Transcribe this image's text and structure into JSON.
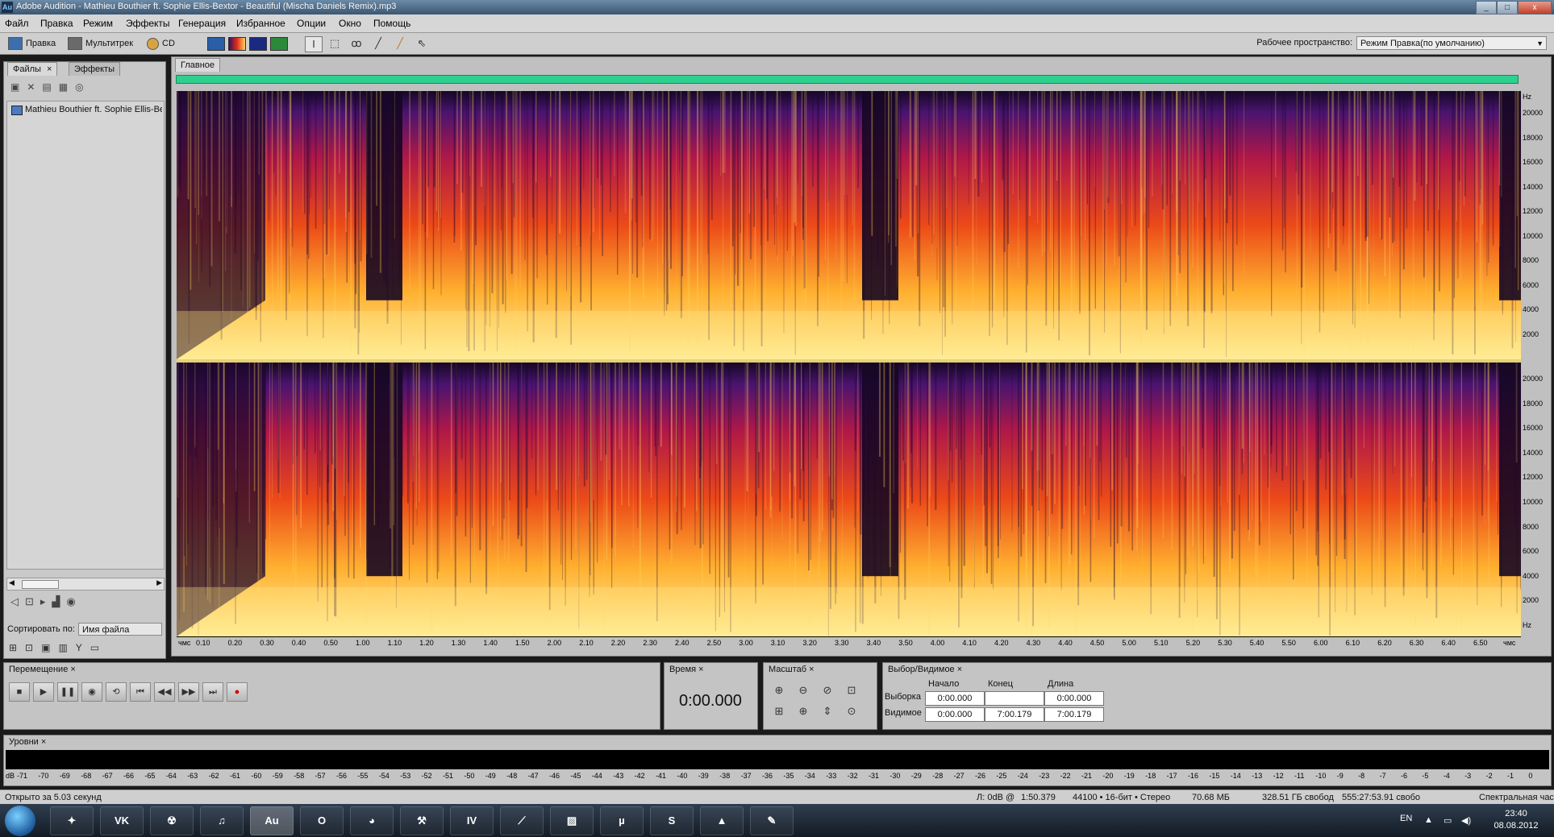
{
  "window": {
    "app_icon": "Au",
    "title": "Adobe Audition - Mathieu Bouthier ft. Sophie Ellis-Bextor - Beautiful (Mischa Daniels Remix).mp3",
    "controls": {
      "minimize": "_",
      "maximize": "□",
      "close": "x"
    }
  },
  "menubar": [
    "Файл",
    "Правка",
    "Режим",
    "Эффекты",
    "Генерация",
    "Избранное",
    "Опции",
    "Окно",
    "Помощь"
  ],
  "toolbar": {
    "mode_edit": "Правка",
    "mode_multitrack": "Мультитрек",
    "mode_cd": "CD",
    "workspace_label": "Рабочее пространство:",
    "workspace_value": "Режим Правка(по умолчанию)",
    "view_buttons": [
      "waveform-view",
      "spectral-frequency-view",
      "spectral-pan-view",
      "spectral-phase-view"
    ],
    "tools": [
      "time-selection-tool",
      "marquee-tool",
      "lasso-tool",
      "effects-paintbrush-tool",
      "spot-healing-tool",
      "scrub-tool"
    ]
  },
  "files_panel": {
    "tabs": [
      "Файлы",
      "Эффекты"
    ],
    "tab_close": "×",
    "files": [
      "Mathieu Bouthier ft. Sophie Ellis-Bextor - Beautiful (Mischa Daniels Remix).mp3"
    ],
    "sort_label": "Сортировать по:",
    "sort_value": "Имя файла"
  },
  "editor": {
    "tab": "Главное",
    "hz_label": "Hz",
    "freq_ticks_ch1": [
      "20000",
      "18000",
      "16000",
      "14000",
      "12000",
      "10000",
      "8000",
      "6000",
      "4000",
      "2000"
    ],
    "freq_ticks_ch2": [
      "20000",
      "18000",
      "16000",
      "14000",
      "12000",
      "10000",
      "8000",
      "6000",
      "4000",
      "2000",
      "Hz"
    ],
    "time_unit": "чмс",
    "time_ticks": [
      "0.10",
      "0.20",
      "0.30",
      "0.40",
      "0.50",
      "1.00",
      "1.10",
      "1.20",
      "1.30",
      "1.40",
      "1.50",
      "2.00",
      "2.10",
      "2.20",
      "2.30",
      "2.40",
      "2.50",
      "3.00",
      "3.10",
      "3.20",
      "3.30",
      "3.40",
      "3.50",
      "4.00",
      "4.10",
      "4.20",
      "4.30",
      "4.40",
      "4.50",
      "5.00",
      "5.10",
      "5.20",
      "5.30",
      "5.40",
      "5.50",
      "6.00",
      "6.10",
      "6.20",
      "6.30",
      "6.40",
      "6.50"
    ],
    "time_end": "чмс"
  },
  "transport": {
    "title": "Перемещение",
    "buttons": [
      "stop",
      "play",
      "pause",
      "play-from-cursor",
      "loop",
      "go-to-start",
      "rewind",
      "fast-forward",
      "go-to-end",
      "record"
    ]
  },
  "time_panel": {
    "title": "Время",
    "value": "0:00.000"
  },
  "zoom_panel": {
    "title": "Масштаб"
  },
  "selection_panel": {
    "title": "Выбор/Видимое",
    "headers": [
      "Начало",
      "Конец",
      "Длина"
    ],
    "rows": [
      {
        "label": "Выборка",
        "start": "0:00.000",
        "end": "",
        "length": "0:00.000"
      },
      {
        "label": "Видимое",
        "start": "0:00.000",
        "end": "7:00.179",
        "length": "7:00.179"
      }
    ]
  },
  "levels": {
    "title": "Уровни",
    "unit": "dB",
    "scale": [
      "-71",
      "-70",
      "-69",
      "-68",
      "-67",
      "-66",
      "-65",
      "-64",
      "-63",
      "-62",
      "-61",
      "-60",
      "-59",
      "-58",
      "-57",
      "-56",
      "-55",
      "-54",
      "-53",
      "-52",
      "-51",
      "-50",
      "-49",
      "-48",
      "-47",
      "-46",
      "-45",
      "-44",
      "-43",
      "-42",
      "-41",
      "-40",
      "-39",
      "-38",
      "-37",
      "-36",
      "-35",
      "-34",
      "-33",
      "-32",
      "-31",
      "-30",
      "-29",
      "-28",
      "-27",
      "-26",
      "-25",
      "-24",
      "-23",
      "-22",
      "-21",
      "-20",
      "-19",
      "-18",
      "-17",
      "-16",
      "-15",
      "-14",
      "-13",
      "-12",
      "-11",
      "-10",
      "-9",
      "-8",
      "-7",
      "-6",
      "-5",
      "-4",
      "-3",
      "-2",
      "-1",
      "0"
    ]
  },
  "statusbar": {
    "opened": "Открыто за 5.03 секунд",
    "peak": "Л: 0dB @",
    "peak_time": "1:50.379",
    "format": "44100 • 16-бит • Стерео",
    "size": "70.68 МБ",
    "free": "328.51 ГБ свобод",
    "free_time": "555:27:53.91 свобо",
    "view": "Спектральная час"
  },
  "taskbar": {
    "apps": [
      "counter-strike",
      "VK",
      "nuclear",
      "itunes",
      "Au",
      "opera",
      "chrome",
      "tools",
      "IV",
      "need-for-speed",
      "brick-game",
      "utorrent",
      "skype",
      "aimp",
      "paint"
    ],
    "lang": "EN",
    "time": "23:40",
    "date": "08.08.2012"
  },
  "colors": {
    "spectrum_hot": "#ffd060",
    "spectrum_mid": "#e03018",
    "spectrum_cold": "#3a1060",
    "overview": "#2ecf8f"
  }
}
